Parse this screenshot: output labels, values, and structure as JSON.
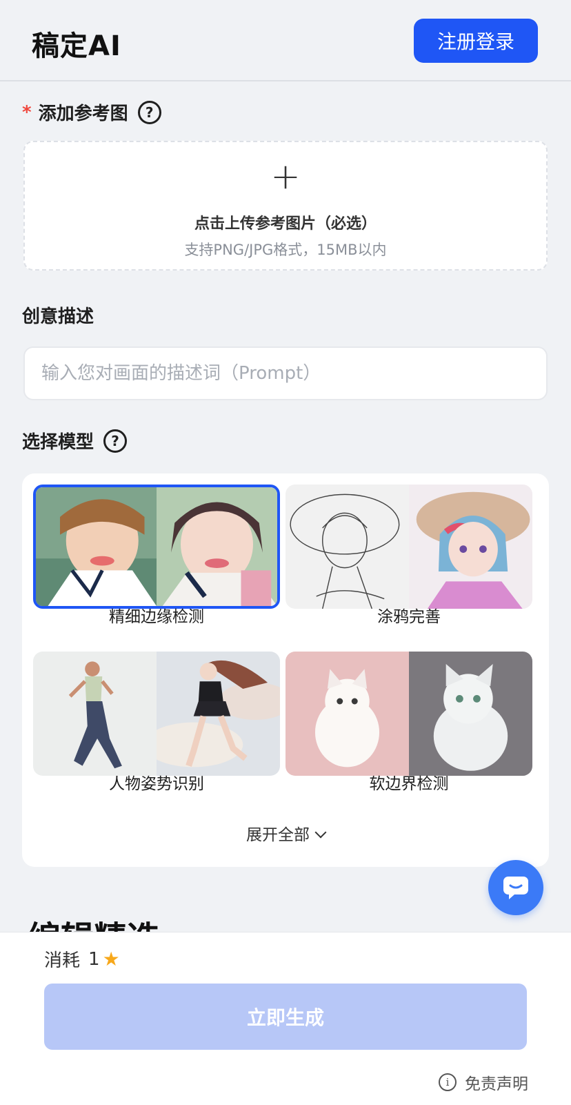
{
  "header": {
    "logo": "稿定AI",
    "login_label": "注册登录"
  },
  "reference": {
    "required_mark": "*",
    "title": "添加参考图",
    "help_icon": "?",
    "plus_icon": "+",
    "upload_main": "点击上传参考图片（必选）",
    "upload_sub": "支持PNG/JPG格式，15MB以内"
  },
  "prompt": {
    "title": "创意描述",
    "placeholder": "输入您对画面的描述词（Prompt）",
    "value": ""
  },
  "model": {
    "title": "选择模型",
    "help_icon": "?",
    "items": [
      {
        "label": "精细边缘检测",
        "selected": true
      },
      {
        "label": "涂鸦完善",
        "selected": false
      },
      {
        "label": "人物姿势识别",
        "selected": false
      },
      {
        "label": "软边界检测",
        "selected": false
      }
    ],
    "expand_label": "展开全部"
  },
  "section_peek": "编辑精选",
  "bottom": {
    "cost_label": "消耗",
    "cost_value": "1",
    "star_icon": "★",
    "generate_label": "立即生成",
    "info_icon": "i",
    "disclaimer": "免责声明"
  },
  "colors": {
    "accent": "#1f56f5",
    "required": "#f0483e",
    "disabled_btn": "#b7c7f7",
    "star": "#f7a81b"
  }
}
